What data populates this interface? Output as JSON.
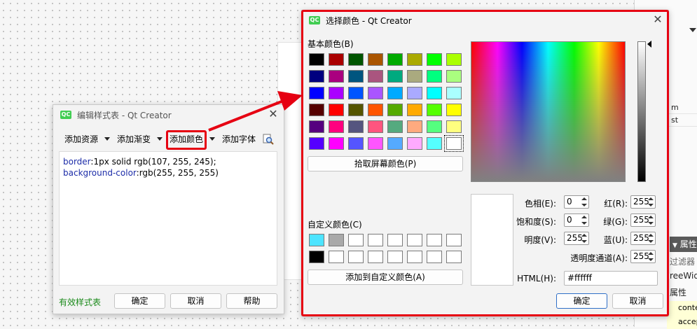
{
  "background": {
    "right_panel_rows": [
      "m",
      "st"
    ],
    "prop_header": "属性",
    "filter_label": "过滤器",
    "tree_label": "reeWid",
    "attr_label": "属性",
    "yellow_rows": [
      "conte",
      "accep"
    ]
  },
  "stylesheet_editor": {
    "title": "编辑样式表 - Qt Creator",
    "logo": "QC",
    "toolbar": {
      "add_resource": "添加资源",
      "add_gradient": "添加渐变",
      "add_color": "添加颜色",
      "add_font": "添加字体"
    },
    "code_lines": [
      {
        "prop": "border",
        "value": ":1px solid rgb(107, 255, 245);"
      },
      {
        "prop": "background-color",
        "value": ":rgb(255, 255, 255)"
      }
    ],
    "valid_label": "有效样式表",
    "ok_label": "确定",
    "cancel_label": "取消",
    "help_label": "帮助"
  },
  "color_dialog": {
    "title": "选择颜色 - Qt Creator",
    "logo": "QC",
    "basic_colors_label": "基本颜色(B)",
    "basic_colors": [
      [
        "#000000",
        "#aa0000",
        "#005500",
        "#aa5500",
        "#00aa00",
        "#aaaa00",
        "#00ff00",
        "#aaff00"
      ],
      [
        "#00007f",
        "#aa007f",
        "#00557f",
        "#aa557f",
        "#00aa7f",
        "#aaaa7f",
        "#00ff7f",
        "#aaff7f"
      ],
      [
        "#0000ff",
        "#aa00ff",
        "#0055ff",
        "#aa55ff",
        "#00aaff",
        "#aaaaff",
        "#00ffff",
        "#aaffff"
      ],
      [
        "#550000",
        "#ff0000",
        "#555500",
        "#ff5500",
        "#55aa00",
        "#ffaa00",
        "#55ff00",
        "#ffff00"
      ],
      [
        "#55007f",
        "#ff007f",
        "#55557f",
        "#ff557f",
        "#55aa7f",
        "#ffaa7f",
        "#55ff7f",
        "#ffff7f"
      ],
      [
        "#5500ff",
        "#ff00ff",
        "#5555ff",
        "#ff55ff",
        "#55aaff",
        "#ffaaff",
        "#55ffff",
        "#ffffff"
      ]
    ],
    "pick_screen_label": "拾取屏幕颜色(P)",
    "custom_colors_label": "自定义颜色(C)",
    "custom_colors": [
      [
        "#4de4ff",
        "#a9a9a9",
        "#ffffff",
        "#ffffff",
        "#ffffff",
        "#ffffff",
        "#ffffff",
        "#ffffff"
      ],
      [
        "#000000",
        "#ffffff",
        "#ffffff",
        "#ffffff",
        "#ffffff",
        "#ffffff",
        "#ffffff",
        "#ffffff"
      ]
    ],
    "add_custom_label": "添加到自定义颜色(A)",
    "fields": {
      "hue_label": "色相(E):",
      "hue": "0",
      "sat_label": "饱和度(S):",
      "sat": "0",
      "val_label": "明度(V):",
      "val": "255",
      "red_label": "红(R):",
      "red": "255",
      "green_label": "绿(G):",
      "green": "255",
      "blue_label": "蓝(U):",
      "blue": "255",
      "alpha_label": "透明度通道(A):",
      "alpha": "255",
      "html_label": "HTML(H):",
      "html": "#ffffff"
    },
    "ok_label": "确定",
    "cancel_label": "取消",
    "selected_color": "#ffffff"
  },
  "colors": {
    "highlight_red": "#e60012",
    "qt_green": "#41cd52",
    "code_blue": "#1c2ca8",
    "valid_green": "#1a8a1a"
  }
}
